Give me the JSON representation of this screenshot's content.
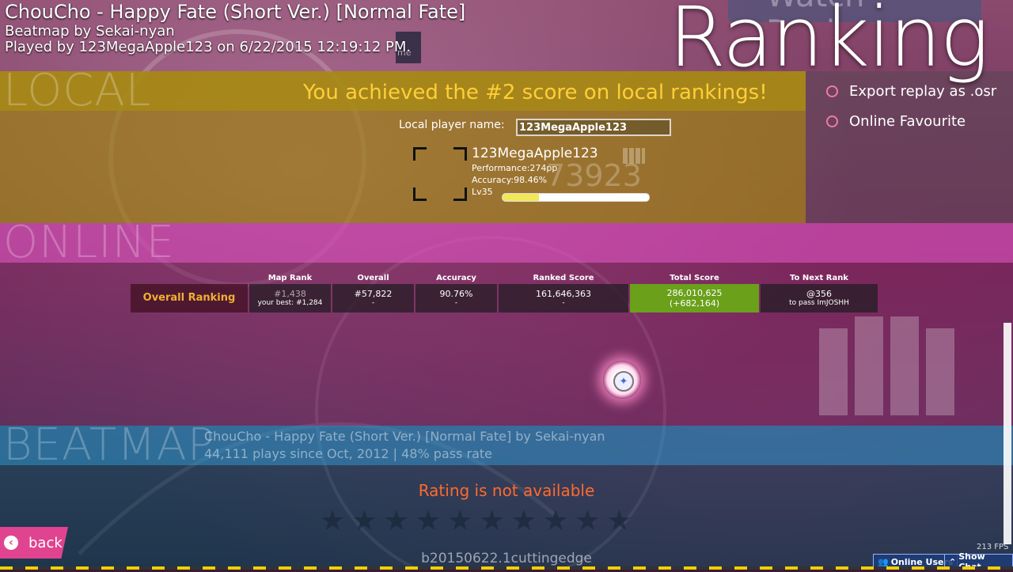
{
  "header": {
    "song": "ChouCho - Happy Fate (Short Ver.) [Normal Fate]",
    "mapper": "Beatmap by Sekai-nyan",
    "played": "Played by 123MegaApple123 on 6/22/2015 12:19:12 PM."
  },
  "screen_title": "Ranking",
  "watch_replay_label": "Watch Replay",
  "hidden_tab_text": "me",
  "local": {
    "section_label": "LOCAL",
    "achievement": "You achieved the #2 score on local rankings!",
    "name_label": "Local player name:",
    "name_value": "123MegaApple123",
    "player": {
      "name": "123MegaApple123",
      "performance": "Performance:274pp",
      "accuracy": "Accuracy:98.46%",
      "level": "Lv35",
      "ghost_rank": "73923",
      "level_progress": 0.25
    }
  },
  "options": [
    {
      "label": "Export replay as .osr"
    },
    {
      "label": "Online Favourite"
    }
  ],
  "online": {
    "section_label": "ONLINE",
    "row_label": "Overall Ranking",
    "columns": [
      {
        "header": "Map Rank",
        "value": "#1,438",
        "sub": "your best: #1,284"
      },
      {
        "header": "Overall",
        "value": "#57,822",
        "sub": "-"
      },
      {
        "header": "Accuracy",
        "value": "90.76%",
        "sub": "-"
      },
      {
        "header": "Ranked Score",
        "value": "161,646,363",
        "sub": "-"
      },
      {
        "header": "Total Score",
        "value": "286,010,625",
        "sub": "(+682,164)"
      },
      {
        "header": "To Next Rank",
        "value": "@356",
        "sub": "to pass ImJOSHH"
      }
    ]
  },
  "beatmap": {
    "section_label": "BEATMAP",
    "title": "ChouCho - Happy Fate (Short Ver.) [Normal Fate] by Sekai-nyan",
    "plays": "44,111 plays since Oct, 2012 | 48% pass rate",
    "rating_message": "Rating is not available"
  },
  "back_label": "back",
  "version": "b20150622.1cuttingedge",
  "fps": "213 FPS",
  "online_users_label": "Online Users",
  "show_chat_label": "Show Chat",
  "colors": {
    "accent_pink": "#e0438f",
    "achievement_gold": "#ffcf37",
    "total_score_green": "#6aa01a",
    "rating_orange": "#ff6a2c"
  }
}
